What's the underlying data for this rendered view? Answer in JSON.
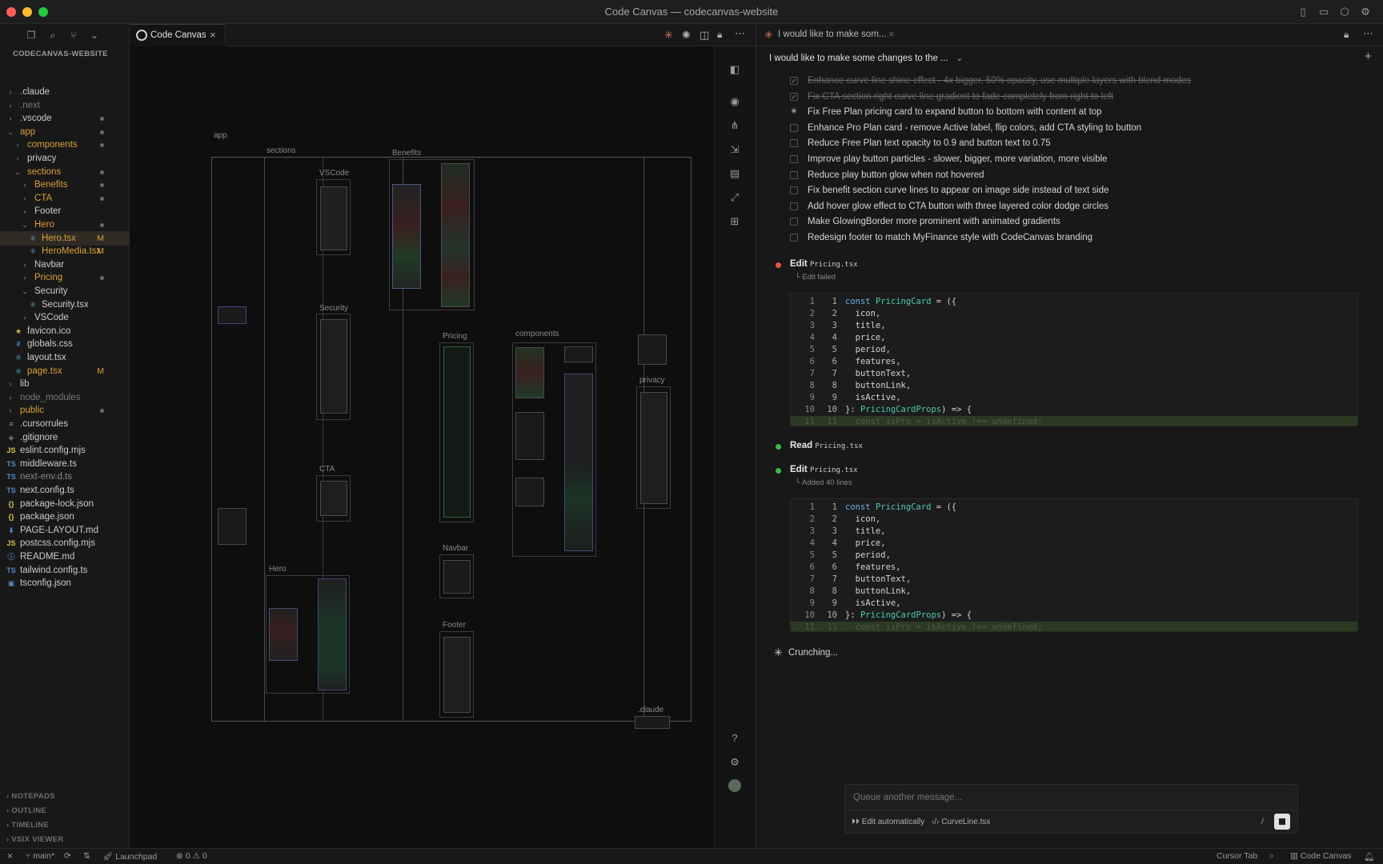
{
  "window": {
    "title": "Code Canvas — codecanvas-website"
  },
  "explorer": {
    "header": "CODECANVAS-WEBSITE",
    "items": [
      {
        "label": ".claude",
        "depth": 0,
        "type": "folder",
        "open": false,
        "status": "",
        "color": "#cccccc"
      },
      {
        "label": ".next",
        "depth": 0,
        "type": "folder",
        "open": false,
        "status": "",
        "color": "#7a7a7a"
      },
      {
        "label": ".vscode",
        "depth": 0,
        "type": "folder",
        "open": false,
        "status": "dot",
        "color": "#cccccc"
      },
      {
        "label": "app",
        "depth": 0,
        "type": "folder",
        "open": true,
        "status": "dot",
        "color": "#d7a03a"
      },
      {
        "label": "components",
        "depth": 1,
        "type": "folder",
        "open": false,
        "status": "dot",
        "color": "#d7a03a"
      },
      {
        "label": "privacy",
        "depth": 1,
        "type": "folder",
        "open": false,
        "status": "",
        "color": "#cccccc"
      },
      {
        "label": "sections",
        "depth": 1,
        "type": "folder",
        "open": true,
        "status": "dot",
        "color": "#d7a03a"
      },
      {
        "label": "Benefits",
        "depth": 2,
        "type": "folder",
        "open": false,
        "status": "dot",
        "color": "#d7a03a"
      },
      {
        "label": "CTA",
        "depth": 2,
        "type": "folder",
        "open": false,
        "status": "dot",
        "color": "#d7a03a"
      },
      {
        "label": "Footer",
        "depth": 2,
        "type": "folder",
        "open": false,
        "status": "",
        "color": "#cccccc"
      },
      {
        "label": "Hero",
        "depth": 2,
        "type": "folder",
        "open": true,
        "status": "dot",
        "color": "#d7a03a"
      },
      {
        "label": "Hero.tsx",
        "depth": 3,
        "type": "react",
        "open": false,
        "status": "M",
        "color": "#d7a03a",
        "selected": true
      },
      {
        "label": "HeroMedia.tsx",
        "depth": 3,
        "type": "react",
        "open": false,
        "status": "M",
        "color": "#d7a03a"
      },
      {
        "label": "Navbar",
        "depth": 2,
        "type": "folder",
        "open": false,
        "status": "",
        "color": "#cccccc"
      },
      {
        "label": "Pricing",
        "depth": 2,
        "type": "folder",
        "open": false,
        "status": "dot",
        "color": "#d7a03a"
      },
      {
        "label": "Security",
        "depth": 2,
        "type": "folder",
        "open": true,
        "status": "",
        "color": "#cccccc"
      },
      {
        "label": "Security.tsx",
        "depth": 3,
        "type": "react",
        "open": false,
        "status": "",
        "color": "#cccccc"
      },
      {
        "label": "VSCode",
        "depth": 2,
        "type": "folder",
        "open": false,
        "status": "",
        "color": "#cccccc"
      },
      {
        "label": "favicon.ico",
        "depth": 1,
        "type": "star",
        "open": false,
        "status": "",
        "color": "#cccccc"
      },
      {
        "label": "globals.css",
        "depth": 1,
        "type": "css",
        "open": false,
        "status": "",
        "color": "#cccccc"
      },
      {
        "label": "layout.tsx",
        "depth": 1,
        "type": "react",
        "open": false,
        "status": "",
        "color": "#cccccc"
      },
      {
        "label": "page.tsx",
        "depth": 1,
        "type": "react",
        "open": false,
        "status": "M",
        "color": "#d7a03a"
      },
      {
        "label": "lib",
        "depth": 0,
        "type": "folder",
        "open": false,
        "status": "",
        "color": "#cccccc"
      },
      {
        "label": "node_modules",
        "depth": 0,
        "type": "folder",
        "open": false,
        "status": "",
        "color": "#7a7a7a"
      },
      {
        "label": "public",
        "depth": 0,
        "type": "folder",
        "open": false,
        "status": "dot",
        "color": "#d7a03a"
      },
      {
        "label": ".cursorrules",
        "depth": 0,
        "type": "lines",
        "open": false,
        "status": "",
        "color": "#cccccc"
      },
      {
        "label": ".gitignore",
        "depth": 0,
        "type": "git",
        "open": false,
        "status": "",
        "color": "#cccccc"
      },
      {
        "label": "eslint.config.mjs",
        "depth": 0,
        "type": "js",
        "open": false,
        "status": "",
        "color": "#cccccc"
      },
      {
        "label": "middleware.ts",
        "depth": 0,
        "type": "ts",
        "open": false,
        "status": "",
        "color": "#cccccc"
      },
      {
        "label": "next-env.d.ts",
        "depth": 0,
        "type": "ts",
        "open": false,
        "status": "",
        "color": "#8a8a8a"
      },
      {
        "label": "next.config.ts",
        "depth": 0,
        "type": "ts",
        "open": false,
        "status": "",
        "color": "#cccccc"
      },
      {
        "label": "package-lock.json",
        "depth": 0,
        "type": "json",
        "open": false,
        "status": "",
        "color": "#cccccc"
      },
      {
        "label": "package.json",
        "depth": 0,
        "type": "json",
        "open": false,
        "status": "",
        "color": "#cccccc"
      },
      {
        "label": "PAGE-LAYOUT.md",
        "depth": 0,
        "type": "md",
        "open": false,
        "status": "",
        "color": "#cccccc"
      },
      {
        "label": "postcss.config.mjs",
        "depth": 0,
        "type": "js",
        "open": false,
        "status": "",
        "color": "#cccccc"
      },
      {
        "label": "README.md",
        "depth": 0,
        "type": "info",
        "open": false,
        "status": "",
        "color": "#cccccc"
      },
      {
        "label": "tailwind.config.ts",
        "depth": 0,
        "type": "ts",
        "open": false,
        "status": "",
        "color": "#cccccc"
      },
      {
        "label": "tsconfig.json",
        "depth": 0,
        "type": "tsconfig",
        "open": false,
        "status": "",
        "color": "#cccccc"
      }
    ],
    "bottom_sections": [
      "NOTEPADS",
      "OUTLINE",
      "TIMELINE",
      "VSIX VIEWER"
    ]
  },
  "editor": {
    "tab_label": "Code Canvas",
    "canvas_labels": {
      "app": "app",
      "sections": "sections",
      "benefits": "Benefits",
      "vscode": "VSCode",
      "security": "Security",
      "pricing": "Pricing",
      "components": "components",
      "privacy": "privacy",
      "cta": "CTA",
      "navbar": "Navbar",
      "hero": "Hero",
      "footer": "Footer",
      "claude": ".claude"
    }
  },
  "chat": {
    "tab_title": "I would like to make som...",
    "conversation_title": "I would like to make some changes to the ...",
    "todos": [
      {
        "text": "Enhance curve line shine effect - 4x bigger, 50% opacity, use multiple layers with blend modes",
        "state": "done"
      },
      {
        "text": "Fix CTA section right curve line gradient to fade completely from right to left",
        "state": "done"
      },
      {
        "text": "Fix Free Plan pricing card to expand button to bottom with content at top",
        "state": "active"
      },
      {
        "text": "Enhance Pro Plan card - remove Active label, flip colors, add CTA styling to button",
        "state": "pending"
      },
      {
        "text": "Reduce Free Plan text opacity to 0.9 and button text to 0.75",
        "state": "pending"
      },
      {
        "text": "Improve play button particles - slower, bigger, more variation, more visible",
        "state": "pending"
      },
      {
        "text": "Reduce play button glow when not hovered",
        "state": "pending"
      },
      {
        "text": "Fix benefit section curve lines to appear on image side instead of text side",
        "state": "pending"
      },
      {
        "text": "Add hover glow effect to CTA button with three layered color dodge circles",
        "state": "pending"
      },
      {
        "text": "Make GlowingBorder more prominent with animated gradients",
        "state": "pending"
      },
      {
        "text": "Redesign footer to match MyFinance style with CodeCanvas branding",
        "state": "pending"
      }
    ],
    "steps": {
      "edit1": {
        "action": "Edit",
        "file": "Pricing.tsx",
        "sub": "Edit failed",
        "color": "#e5534b"
      },
      "read": {
        "action": "Read",
        "file": "Pricing.tsx",
        "color": "#3fb950"
      },
      "edit2": {
        "action": "Edit",
        "file": "Pricing.tsx",
        "sub": "Added 40 lines",
        "color": "#3fb950"
      }
    },
    "code_lines": [
      {
        "n": "1",
        "text": "const PricingCard = ({"
      },
      {
        "n": "2",
        "text": "  icon,"
      },
      {
        "n": "3",
        "text": "  title,"
      },
      {
        "n": "4",
        "text": "  price,"
      },
      {
        "n": "5",
        "text": "  period,"
      },
      {
        "n": "6",
        "text": "  features,"
      },
      {
        "n": "7",
        "text": "  buttonText,"
      },
      {
        "n": "8",
        "text": "  buttonLink,"
      },
      {
        "n": "9",
        "text": "  isActive,"
      },
      {
        "n": "10",
        "text": "}: PricingCardProps) => {"
      },
      {
        "n": "11",
        "text": "  const isPro = isActive !== undefined;"
      }
    ],
    "status": "Crunching...",
    "input": {
      "placeholder": "Queue another message...",
      "mode": "Edit automatically",
      "context_file": "CurveLine.tsx",
      "slash": "/"
    }
  },
  "statusbar": {
    "branch": "main*",
    "launchpad": "Launchpad",
    "errors": "0",
    "warnings": "0",
    "cursor_tab": "Cursor Tab",
    "code_canvas": "Code Canvas"
  },
  "colors": {
    "accent": "#d7a03a",
    "success": "#3fb950",
    "error": "#e5534b"
  }
}
